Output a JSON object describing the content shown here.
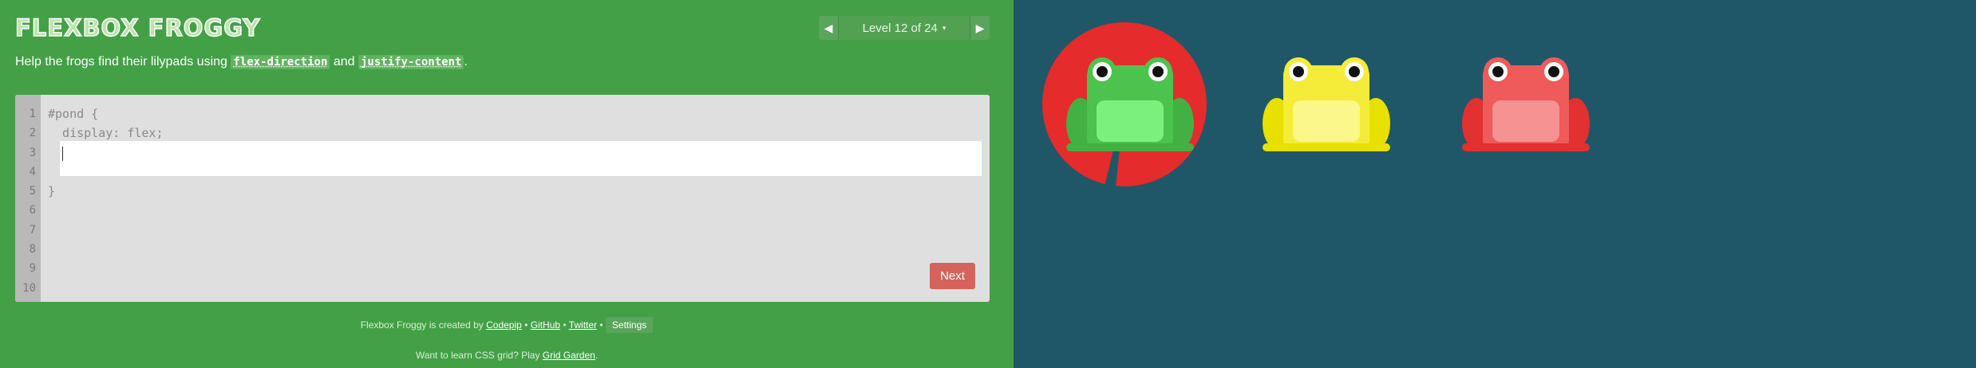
{
  "app": {
    "title": "FLEXBOX FROGGY"
  },
  "level_nav": {
    "prev_icon": "triangle-left",
    "next_icon": "triangle-right",
    "label": "Level 12 of 24",
    "caret": "▾"
  },
  "instructions": {
    "prefix": "Help the frogs find their lilypads using ",
    "code1": "flex-direction",
    "middle": " and ",
    "code2": "justify-content",
    "suffix": "."
  },
  "editor": {
    "line_numbers": [
      "1",
      "2",
      "3",
      "4",
      "5",
      "6",
      "7",
      "8",
      "9",
      "10"
    ],
    "line1": "#pond {",
    "line2": "  display: flex;",
    "line5": "}",
    "input_value": "",
    "next_label": "Next"
  },
  "footer": {
    "credit_prefix": "Flexbox Froggy is created by ",
    "codepip": "Codepip",
    "sep1": " • ",
    "github": "GitHub",
    "sep2": " • ",
    "twitter": "Twitter",
    "sep3": " • ",
    "settings": "Settings",
    "promo_prefix": "Want to learn CSS grid? Play ",
    "grid_garden": "Grid Garden",
    "promo_suffix": "."
  },
  "pond": {
    "lilypad_color": "red",
    "frogs": [
      {
        "color": "green"
      },
      {
        "color": "yellow"
      },
      {
        "color": "red"
      }
    ]
  },
  "colors": {
    "sidebar": "#43a047",
    "pond": "#1f5768",
    "next_button": "#d3635b",
    "lilypad_red": "#e52b2b",
    "frog_green": "#4cc34c",
    "frog_yellow": "#f4ec38",
    "frog_red": "#ef5a5a"
  }
}
